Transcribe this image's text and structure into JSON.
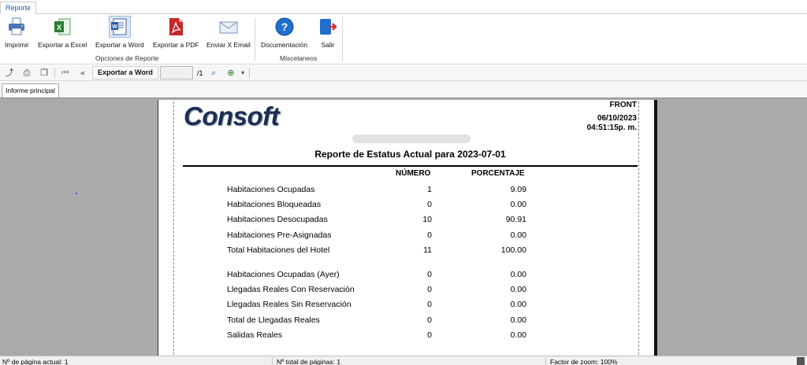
{
  "ribbon": {
    "tab": "Reporte",
    "buttons": {
      "imprimir": "Imprimir",
      "excel": "Exportar a Excel",
      "word": "Exportar a Word",
      "pdf": "Exportar a PDF",
      "email": "Enviar X Email",
      "doc": "Documentación",
      "salir": "Salir"
    },
    "groups": {
      "opciones": "Opciones de Reporte",
      "misc": "Miscelaneos"
    }
  },
  "toolbar": {
    "export_label": "Exportar a Word",
    "page_input": "",
    "page_total": "/1"
  },
  "doc_tab": "Informe principal",
  "report": {
    "logo": "Consoft",
    "front": "FRONT",
    "date": "06/10/2023",
    "time": "04:51:15p. m.",
    "title": "Reporte de Estatus Actual para 2023-07-01",
    "col_numero": "NÚMERO",
    "col_porcentaje": "PORCENTAJE",
    "rows": [
      {
        "label": "Habitaciones Ocupadas",
        "num": "1",
        "pct": "9.09"
      },
      {
        "label": "Habitaciones Bloqueadas",
        "num": "0",
        "pct": "0.00"
      },
      {
        "label": "Habitaciones Desocupadas",
        "num": "10",
        "pct": "90.91"
      },
      {
        "label": "Habitaciones Pre-Asignadas",
        "num": "0",
        "pct": "0.00"
      },
      {
        "label": "Total Habitaciones del Hotel",
        "num": "11",
        "pct": "100.00"
      },
      {
        "label": "Habitaciones Ocupadas (Ayer)",
        "num": "0",
        "pct": "0.00"
      },
      {
        "label": "Llegadas Reales Con Reservación",
        "num": "0",
        "pct": "0.00"
      },
      {
        "label": "Llegadas Reales Sin Reservación",
        "num": "0",
        "pct": "0.00"
      },
      {
        "label": "Total de Llegadas Reales",
        "num": "0",
        "pct": "0.00"
      },
      {
        "label": "Salidas Reales",
        "num": "0",
        "pct": "0.00"
      }
    ]
  },
  "status": {
    "current_page": "Nº de página actual: 1",
    "total_pages": "Nº total de páginas: 1",
    "zoom": "Factor de zoom: 100%"
  },
  "colors": {
    "accent": "#1e5fa8",
    "viewer_bg": "#aaaaaa",
    "logo": "#1c2f52"
  }
}
